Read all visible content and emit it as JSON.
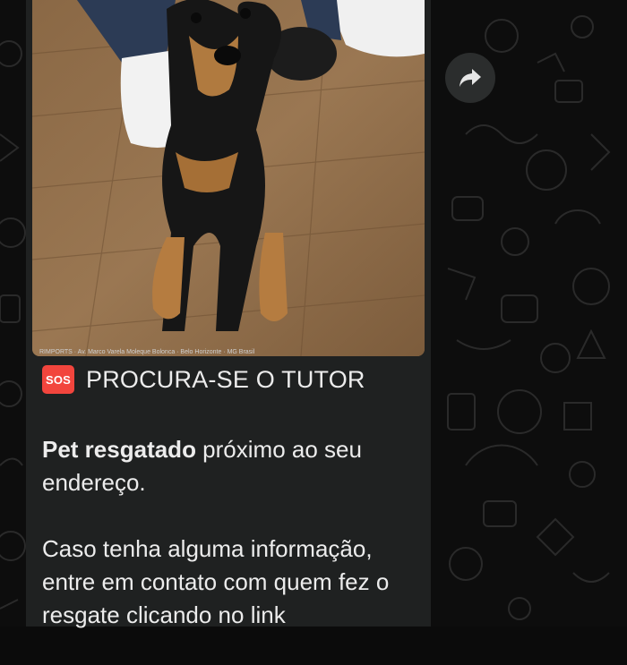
{
  "photo": {
    "alt": "Cachorro preto e caramelo deitado no piso de madeira",
    "caption": "RIMPORTS · Av. Marco Varela Moleque Bolonca · Belo Horizonte · MG Brasil"
  },
  "message": {
    "badge": "SOS",
    "title": "PROCURA-SE O TUTOR",
    "p1_bold": "Pet resgatado",
    "p1_rest": " próximo ao seu endereço.",
    "p2": "Caso tenha alguma informação, entre em contato com quem fez o resgate clicando no link"
  },
  "actions": {
    "forward_icon": "forward-arrow-icon"
  },
  "colors": {
    "chat_background": "#0d0d0d",
    "bubble": "#1f2121",
    "text": "#ececec",
    "sos_badge": "#f2453d",
    "forward_button": "#2b2d2d"
  }
}
